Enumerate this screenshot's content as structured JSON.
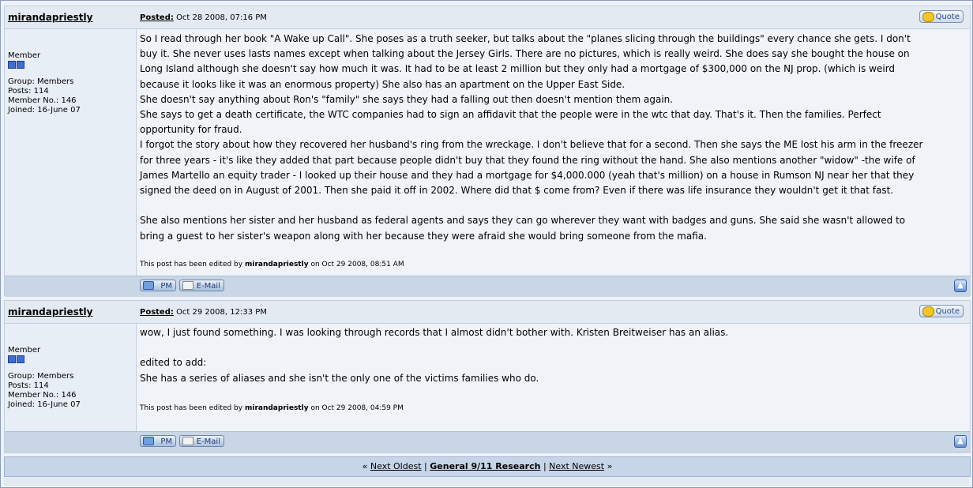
{
  "posts": [
    {
      "author": "mirandapriestly",
      "posted_label": "Posted:",
      "posted_date": "Oct 28 2008, 07:16 PM",
      "quote_label": "Quote",
      "rank": "Member",
      "group": "Group: Members",
      "posts": "Posts: 114",
      "member_no": "Member No.: 146",
      "joined": "Joined: 16-June 07",
      "body": [
        "So I read through her book \"A Wake up Call\". She poses as a truth seeker, but talks about the \"planes slicing through the buildings\" every chance she gets. I don't",
        "buy it. She never uses lasts names except when talking about the Jersey Girls. There are no pictures, which is really weird. She does say she bought the house on",
        "Long Island although she doesn't say how much it was. It had to be at least 2 million but they only had a mortgage of $300,000 on the NJ prop. (which is weird",
        "because it looks like it was an enormous property) She also has an apartment on the Upper East Side.",
        "She doesn't say anything about Ron's \"family\" she says they had a falling out then doesn't mention them again.",
        "She says to get a death certificate, the WTC companies had to sign an affidavit that the people were in the wtc that day. That's it. Then the families. Perfect",
        "opportunity for fraud.",
        "I forgot the story about how they recovered her husband's ring from the wreckage. I don't believe that for a second. Then she says the ME lost his arm in the freezer",
        "for three years - it's like they added that part because people didn't buy that they found the ring without the hand. She also mentions another \"widow\" -the wife of",
        "James Martello an equity trader - I looked up their house and they had a mortgage for $4,000.000 (yeah that's million) on a house in Rumson NJ near her that they",
        "signed the deed on in August of 2001. Then she paid it off in 2002. Where did that $ come from? Even if there was life insurance they wouldn't get it that fast.",
        "",
        "She also mentions her sister and her husband as federal agents and says they can go wherever they want with badges and guns. She said she wasn't allowed to",
        "bring a guest to her sister's weapon along with her because they were afraid she would bring someone from the mafia."
      ],
      "edited_prefix": "This post has been edited by",
      "edited_by": "mirandapriestly",
      "edited_suffix": "on Oct 29 2008, 08:51 AM",
      "pm_label": "PM",
      "email_label": "E-Mail"
    },
    {
      "author": "mirandapriestly",
      "posted_label": "Posted:",
      "posted_date": "Oct 29 2008, 12:33 PM",
      "quote_label": "Quote",
      "rank": "Member",
      "group": "Group: Members",
      "posts": "Posts: 114",
      "member_no": "Member No.: 146",
      "joined": "Joined: 16-June 07",
      "body": [
        "wow, I just found something. I was looking through records that I almost didn't bother with. Kristen Breitweiser has an alias.",
        "",
        "edited to add:",
        "She has a series of aliases and she isn't the only one of the victims families who do."
      ],
      "edited_prefix": "This post has been edited by",
      "edited_by": "mirandapriestly",
      "edited_suffix": "on Oct 29 2008, 04:59 PM",
      "pm_label": "PM",
      "email_label": "E-Mail"
    }
  ],
  "nav": {
    "prev_arrow": "«",
    "next_oldest": "Next Oldest",
    "sep1": "|",
    "forum": "General 9/11 Research",
    "sep2": "|",
    "next_newest": "Next Newest",
    "next_arrow": "»"
  },
  "icons": {
    "quote": "quote-icon",
    "pm": "pm-icon",
    "email": "email-icon",
    "top": "back-to-top-icon",
    "rank_pips": "member-rank-pips-icon"
  }
}
